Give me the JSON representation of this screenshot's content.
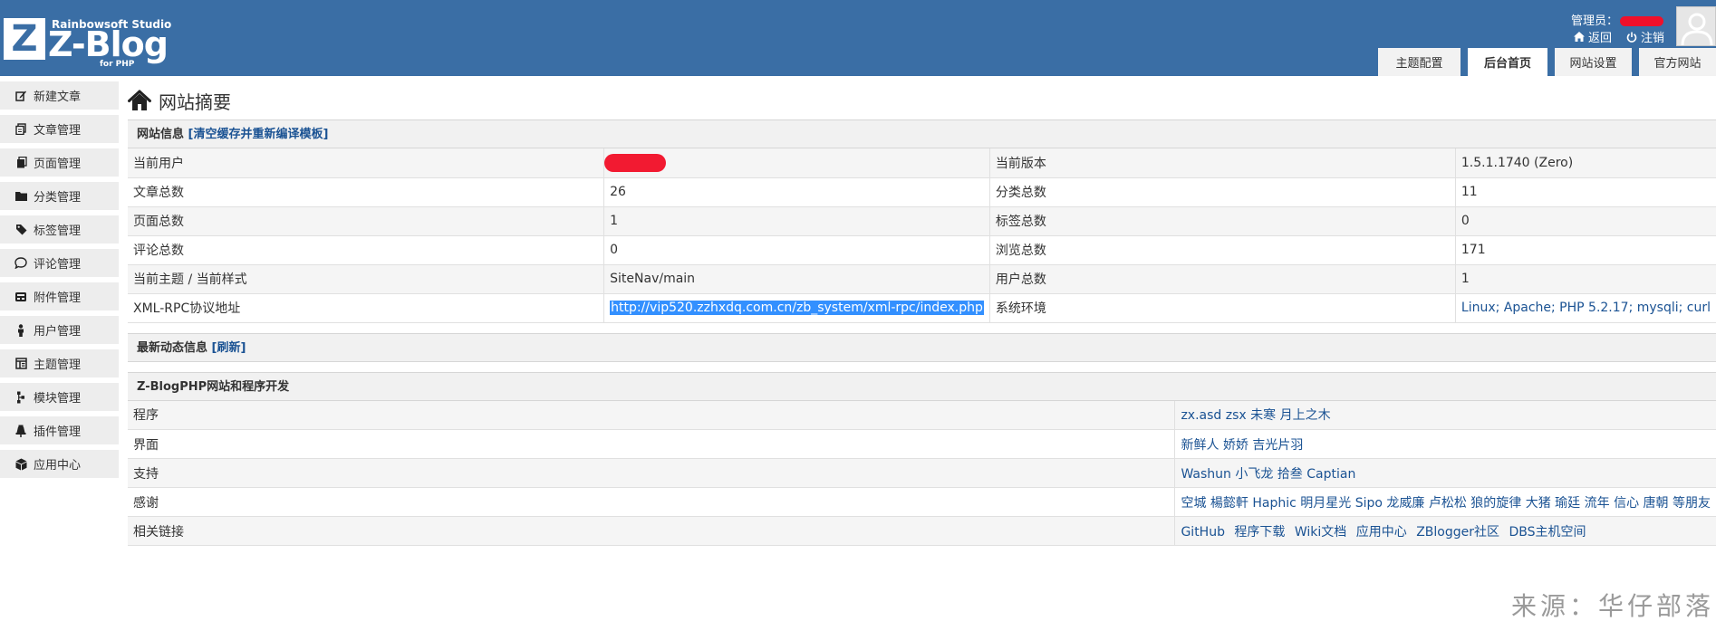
{
  "header": {
    "logo_letter": "Z",
    "brand_top": "Rainbowsoft Studio",
    "brand_name": "Z-Blog",
    "brand_sub": "for PHP",
    "admin_label": "管理员：",
    "back_label": "返回",
    "logout_label": "注销",
    "tabs": [
      {
        "label": "主题配置",
        "active": false
      },
      {
        "label": "后台首页",
        "active": true
      },
      {
        "label": "网站设置",
        "active": false
      },
      {
        "label": "官方网站",
        "active": false
      }
    ],
    "bg_color": "#3a6ea5"
  },
  "sidebar": {
    "items": [
      {
        "label": "新建文章",
        "icon": "edit-icon"
      },
      {
        "label": "文章管理",
        "icon": "documents-icon"
      },
      {
        "label": "页面管理",
        "icon": "page-icon"
      },
      {
        "label": "分类管理",
        "icon": "folder-icon"
      },
      {
        "label": "标签管理",
        "icon": "tag-icon"
      },
      {
        "label": "评论管理",
        "icon": "comment-icon"
      },
      {
        "label": "附件管理",
        "icon": "attachment-icon"
      },
      {
        "label": "用户管理",
        "icon": "user-icon"
      },
      {
        "label": "主题管理",
        "icon": "theme-icon"
      },
      {
        "label": "模块管理",
        "icon": "module-icon"
      },
      {
        "label": "插件管理",
        "icon": "plugin-icon"
      },
      {
        "label": "应用中心",
        "icon": "box-icon"
      }
    ]
  },
  "main": {
    "title": "网站摘要",
    "site_info": {
      "head": "网站信息",
      "head_link": "[清空缓存并重新编译模板]",
      "rows": [
        {
          "k1": "当前用户",
          "v1": "",
          "k2": "当前版本",
          "v2": "1.5.1.1740 (Zero)"
        },
        {
          "k1": "文章总数",
          "v1": "26",
          "k2": "分类总数",
          "v2": "11"
        },
        {
          "k1": "页面总数",
          "v1": "1",
          "k2": "标签总数",
          "v2": "0"
        },
        {
          "k1": "评论总数",
          "v1": "0",
          "k2": "浏览总数",
          "v2": "171"
        },
        {
          "k1": "当前主题 / 当前样式",
          "v1": "SiteNav/main",
          "k2": "用户总数",
          "v2": "1"
        },
        {
          "k1": "XML-RPC协议地址",
          "v1": "http://vip520.zzhxdq.com.cn/zb_system/xml-rpc/index.php",
          "k2": "系统环境",
          "v2": "Linux; Apache; PHP 5.2.17; mysqli; curl"
        }
      ]
    },
    "news": {
      "head": "最新动态信息",
      "head_link": "[刷新]"
    },
    "dev": {
      "head": "Z-BlogPHP网站和程序开发",
      "rows": [
        {
          "k": "程序",
          "v": "zx.asd zsx 未寒 月上之木"
        },
        {
          "k": "界面",
          "v": "新鲜人 娇娇 吉光片羽"
        },
        {
          "k": "支持",
          "v": "Washun 小飞龙 拾叁 Captian"
        },
        {
          "k": "感谢",
          "v": "空城 楊懿軒 Haphic 明月星光 Sipo 龙威廉 卢松松 狼的旋律 大猪 瑜廷 流年 信心 唐朝 等朋友"
        }
      ],
      "links_label": "相关链接",
      "links": [
        "GitHub",
        "程序下载",
        "Wiki文档",
        "应用中心",
        "ZBlogger社区",
        "DBS主机空间"
      ]
    }
  },
  "watermark": "来源：华仔部落"
}
